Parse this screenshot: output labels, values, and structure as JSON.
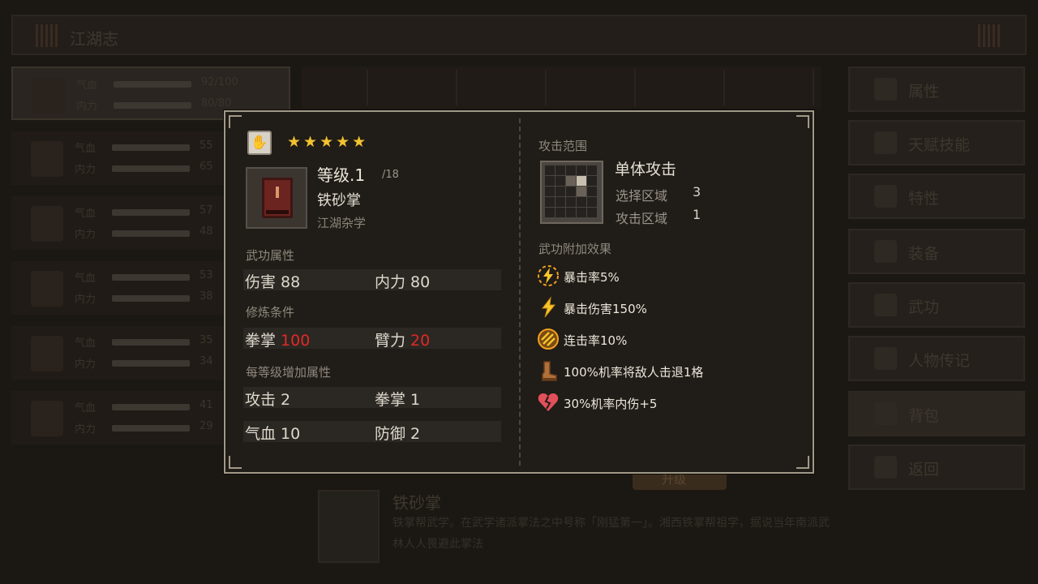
{
  "background": {
    "top_title": "江湖志",
    "character_rows": [
      {
        "hp_label": "气血",
        "mp_label": "内力",
        "hp_num": "92/100",
        "mp_num": "80/80"
      },
      {
        "hp_label": "气血",
        "mp_label": "内力",
        "hp_num": "55",
        "mp_num": "65"
      },
      {
        "hp_label": "气血",
        "mp_label": "内力",
        "hp_num": "57",
        "mp_num": "48"
      },
      {
        "hp_label": "气血",
        "mp_label": "内力",
        "hp_num": "53",
        "mp_num": "38"
      },
      {
        "hp_label": "气血",
        "mp_label": "内力",
        "hp_num": "35",
        "mp_num": "34"
      },
      {
        "hp_label": "气血",
        "mp_label": "内力",
        "hp_num": "41",
        "mp_num": "29"
      }
    ],
    "menu": [
      {
        "label": "属性",
        "icon": "person-icon"
      },
      {
        "label": "天赋技能",
        "icon": "talent-icon"
      },
      {
        "label": "特性",
        "icon": "trait-icon"
      },
      {
        "label": "装备",
        "icon": "sword-icon"
      },
      {
        "label": "武功",
        "icon": "martial-book-icon"
      },
      {
        "label": "人物传记",
        "icon": "biography-icon"
      },
      {
        "label": "背包",
        "icon": "bag-icon"
      },
      {
        "label": "返回",
        "icon": "door-icon"
      }
    ],
    "upgrade_label": "升级",
    "desc_name": "铁砂掌",
    "desc_text": "铁掌帮武学。在武学诸派掌法之中号称「刚猛第一」。湘西铁掌帮祖学，据说当年南派武林人人畏避此掌法"
  },
  "modal": {
    "stars": "★★★★★",
    "star_count": 5,
    "level_label": "等级.1",
    "level_max": "/18",
    "skill_name": "铁砂掌",
    "skill_category": "江湖杂学",
    "section_attrs": "武功属性",
    "attrs": [
      {
        "label": "伤害",
        "value": "88"
      },
      {
        "label": "内力",
        "value": "80"
      }
    ],
    "section_requirements": "修炼条件",
    "requirements": [
      {
        "label": "拳掌",
        "value": "100"
      },
      {
        "label": "臂力",
        "value": "20"
      }
    ],
    "section_per_level": "每等级增加属性",
    "per_level": [
      {
        "label": "攻击",
        "value": "2"
      },
      {
        "label": "拳掌",
        "value": "1"
      },
      {
        "label": "气血",
        "value": "10"
      },
      {
        "label": "防御",
        "value": "2"
      }
    ],
    "range_title": "攻击范围",
    "attack_type": "单体攻击",
    "select_area_label": "选择区域",
    "select_area_value": "3",
    "attack_area_label": "攻击区域",
    "attack_area_value": "1",
    "effects_title": "武功附加效果",
    "effects": [
      {
        "icon": "crit-rate-icon",
        "text": "暴击率5%"
      },
      {
        "icon": "crit-damage-icon",
        "text": "暴击伤害150%"
      },
      {
        "icon": "combo-rate-icon",
        "text": "连击率10%"
      },
      {
        "icon": "boot-knockback-icon",
        "text": "100%机率将敌人击退1格"
      },
      {
        "icon": "broken-heart-icon",
        "text": "30%机率内伤+5"
      }
    ],
    "colors": {
      "star": "#f2c230",
      "unmet_requirement": "#e02a24",
      "frame": "#a09988"
    }
  }
}
